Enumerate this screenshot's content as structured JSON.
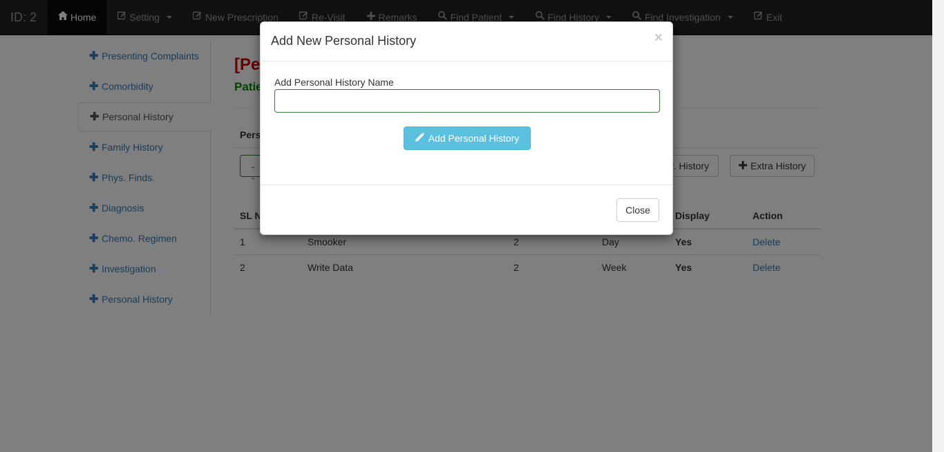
{
  "navbar": {
    "brand": "ID: 2",
    "items": [
      {
        "label": "Home",
        "icon": "home-icon",
        "active": true
      },
      {
        "label": "Setting",
        "icon": "edit-icon",
        "dropdown": true
      },
      {
        "label": "New Prescription",
        "icon": "edit-icon"
      },
      {
        "label": "Re-Visit",
        "icon": "edit-icon"
      },
      {
        "label": "Remarks",
        "icon": "plus-icon"
      },
      {
        "label": "Find Patient",
        "icon": "search-icon",
        "dropdown": true
      },
      {
        "label": "Find History",
        "icon": "search-icon",
        "dropdown": true
      },
      {
        "label": "Find Investigation",
        "icon": "search-icon",
        "dropdown": true
      },
      {
        "label": "Exit",
        "icon": "edit-icon"
      }
    ]
  },
  "sidebar": {
    "items": [
      {
        "label": "Presenting Complaints"
      },
      {
        "label": "Comorbidity"
      },
      {
        "label": "Personal History",
        "active": true
      },
      {
        "label": "Family History"
      },
      {
        "label": "Phys. Finds."
      },
      {
        "label": "Diagnosis"
      },
      {
        "label": "Chemo. Regimen"
      },
      {
        "label": "Investigation"
      },
      {
        "label": "Personal History"
      }
    ]
  },
  "main": {
    "title_fragment": "[Pe",
    "subtitle_fragment": "Patie",
    "section_label_fragment": "Pers",
    "outline_button_text": "--",
    "history_button_fragment": "r. History",
    "extra_history_label": "Extra History",
    "table": {
      "headers": [
        "SL N",
        "",
        "",
        "",
        "Display",
        "Action"
      ],
      "rows": [
        {
          "sl": "1",
          "name": "Smooker",
          "value": "2",
          "unit": "Day",
          "display": "Yes",
          "action": "Delete"
        },
        {
          "sl": "2",
          "name": "Write Data",
          "value": "2",
          "unit": "Week",
          "display": "Yes",
          "action": "Delete"
        }
      ]
    }
  },
  "modal": {
    "title": "Add New Personal History",
    "close_x": "×",
    "field_label": "Add Personal History Name",
    "field_value": "",
    "submit_label": "Add Personal History",
    "close_label": "Close"
  },
  "colors": {
    "navbar_bg": "#222222",
    "link": "#337ab7",
    "title_red": "#cc0000",
    "subtitle_green": "#008800",
    "info_button": "#5bc0de"
  }
}
